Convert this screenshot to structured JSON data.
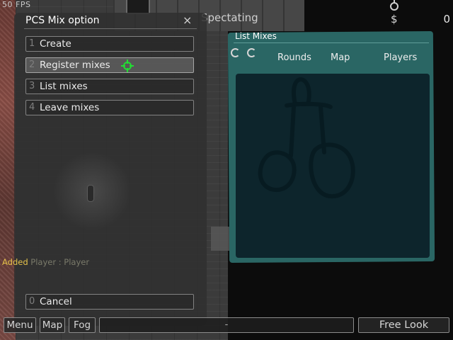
{
  "hud": {
    "fps": "50 FPS",
    "status": "Spectating",
    "money_symbol": "$",
    "money": "0"
  },
  "mix_menu": {
    "title": "PCS Mix option",
    "close": "×",
    "options": [
      {
        "num": "1",
        "label": "Create"
      },
      {
        "num": "2",
        "label": "Register mixes"
      },
      {
        "num": "3",
        "label": "List mixes"
      },
      {
        "num": "4",
        "label": "Leave mixes"
      }
    ],
    "cancel": {
      "num": "0",
      "label": "Cancel"
    }
  },
  "list_mixes": {
    "title": "List Mixes",
    "columns": [
      "Rounds",
      "Map",
      "Players"
    ]
  },
  "chat": {
    "who": "Added",
    "message": " Player : Player"
  },
  "bottom_bar": {
    "menu": "Menu",
    "map": "Map",
    "fog": "Fog",
    "chat_input": "-",
    "free_look": "Free Look"
  },
  "colors": {
    "panel_teal": "#2a6664",
    "panel_inner": "#0d252c",
    "chat_name": "#e6c24a",
    "cursor_green": "#22dd33"
  }
}
